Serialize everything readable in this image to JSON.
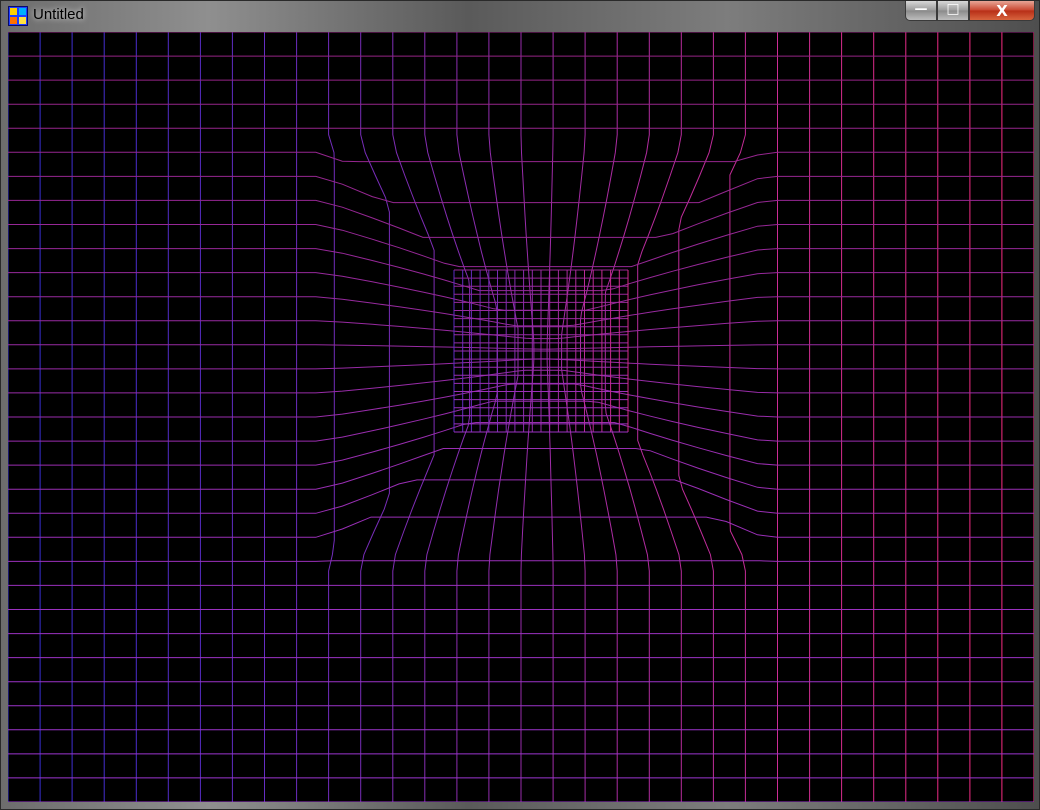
{
  "window": {
    "title": "Untitled",
    "controls": {
      "minimize_glyph": "—",
      "maximize_glyph": "□",
      "close_glyph": "X"
    }
  },
  "icons": {
    "app": "qb64-app-icon",
    "minimize": "minimize-icon",
    "maximize": "maximize-icon",
    "close": "close-icon"
  },
  "colors": {
    "canvas_background": "#000000",
    "grid_top_left": "#2a2cc8",
    "grid_top_right": "#ff1a3c",
    "grid_bottom_left": "#3a30e8",
    "grid_bottom_right": "#ff3cc0",
    "grid_center": "#c0208a"
  }
}
